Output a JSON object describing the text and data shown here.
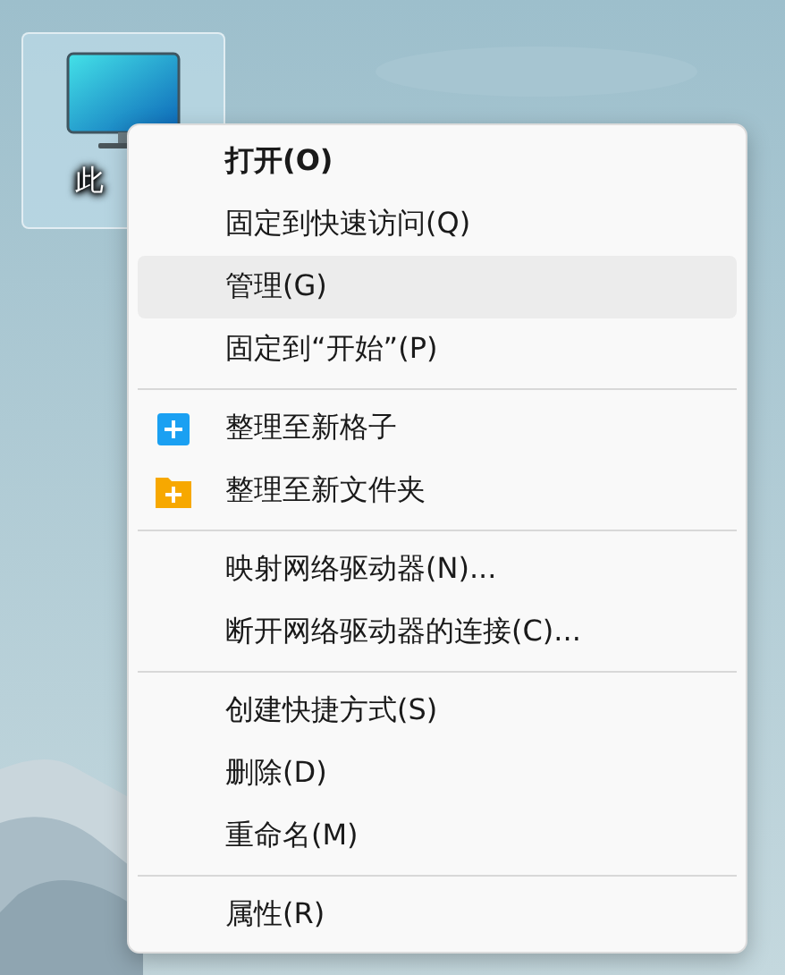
{
  "desktop_icon": {
    "label": "此",
    "selected": true
  },
  "context_menu": {
    "groups": [
      {
        "items": [
          {
            "label": "打开(O)",
            "bold": true,
            "highlighted": false
          },
          {
            "label": "固定到快速访问(Q)",
            "bold": false,
            "highlighted": false
          },
          {
            "label": "管理(G)",
            "bold": false,
            "highlighted": true
          },
          {
            "label": "固定到“开始”(P)",
            "bold": false,
            "highlighted": false
          }
        ]
      },
      {
        "items": [
          {
            "label": "整理至新格子",
            "bold": false,
            "highlighted": false,
            "kind": "tile"
          },
          {
            "label": "整理至新文件夹",
            "bold": false,
            "highlighted": false,
            "kind": "folder"
          }
        ]
      },
      {
        "items": [
          {
            "label": "映射网络驱动器(N)...",
            "bold": false,
            "highlighted": false
          },
          {
            "label": "断开网络驱动器的连接(C)...",
            "bold": false,
            "highlighted": false
          }
        ]
      },
      {
        "items": [
          {
            "label": "创建快捷方式(S)",
            "bold": false,
            "highlighted": false
          },
          {
            "label": "删除(D)",
            "bold": false,
            "highlighted": false
          },
          {
            "label": "重命名(M)",
            "bold": false,
            "highlighted": false
          }
        ]
      },
      {
        "items": [
          {
            "label": "属性(R)",
            "bold": false,
            "highlighted": false
          }
        ]
      }
    ]
  }
}
